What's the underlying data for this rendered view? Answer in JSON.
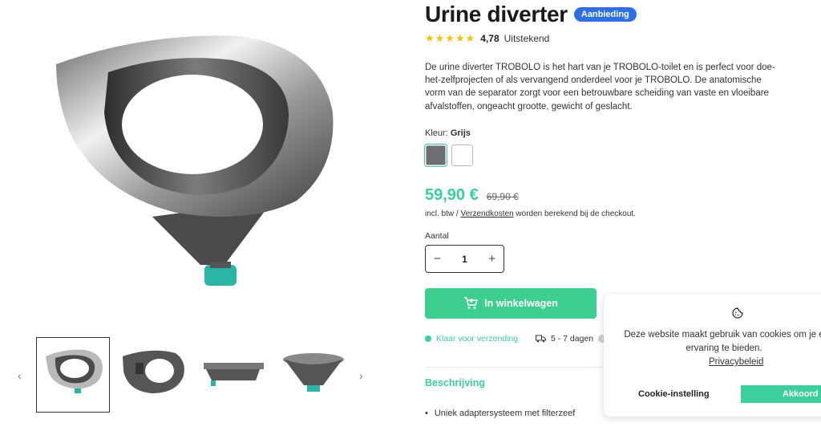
{
  "product": {
    "title": "Urine diverter",
    "badge": "Aanbieding",
    "rating_value": "4,78",
    "rating_text": "Uitstekend",
    "description": "De urine diverter TROBOLO is het hart van je TROBOLO-toilet en is perfect voor doe-het-zelfprojecten of als vervangend onderdeel voor je TROBOLO. De anatomische vorm van de separator zorgt voor een betrouwbare scheiding van vaste en vloeibare afvalstoffen, ongeacht grootte, gewicht of geslacht.",
    "color_label": "Kleur:",
    "color_value": "Grijs",
    "swatches": [
      {
        "name": "Grijs",
        "color": "#6d6e71"
      },
      {
        "name": "Wit",
        "color": "#ffffff"
      }
    ],
    "price": "59,90 €",
    "old_price": "69,90 €",
    "tax_prefix": "incl. btw / ",
    "tax_link": "Verzendkosten",
    "tax_suffix": " worden berekend bij de checkout.",
    "quantity_label": "Aantal",
    "quantity": "1",
    "cart_button": "In winkelwagen",
    "stock": "Klaar voor verzending",
    "delivery": "5 - 7 dagen",
    "section_heading": "Beschrijving",
    "bullet": "Uniek adaptersysteem met filterzeef"
  },
  "gallery": {
    "prev_icon": "chevron-left-icon",
    "next_icon": "chevron-right-icon",
    "thumbs": [
      "thumb-1",
      "thumb-2",
      "thumb-3",
      "thumb-4"
    ]
  },
  "cookie": {
    "line1": "Deze website maakt gebruik van cookies om je e",
    "line2": "ervaring te bieden.",
    "privacy": "Privacybeleid",
    "settings": "Cookie-instelling",
    "accept": "Akkoord"
  },
  "colors": {
    "accent": "#3ccf9b",
    "badge": "#2f6fe4",
    "stars": "#f4c20d"
  }
}
